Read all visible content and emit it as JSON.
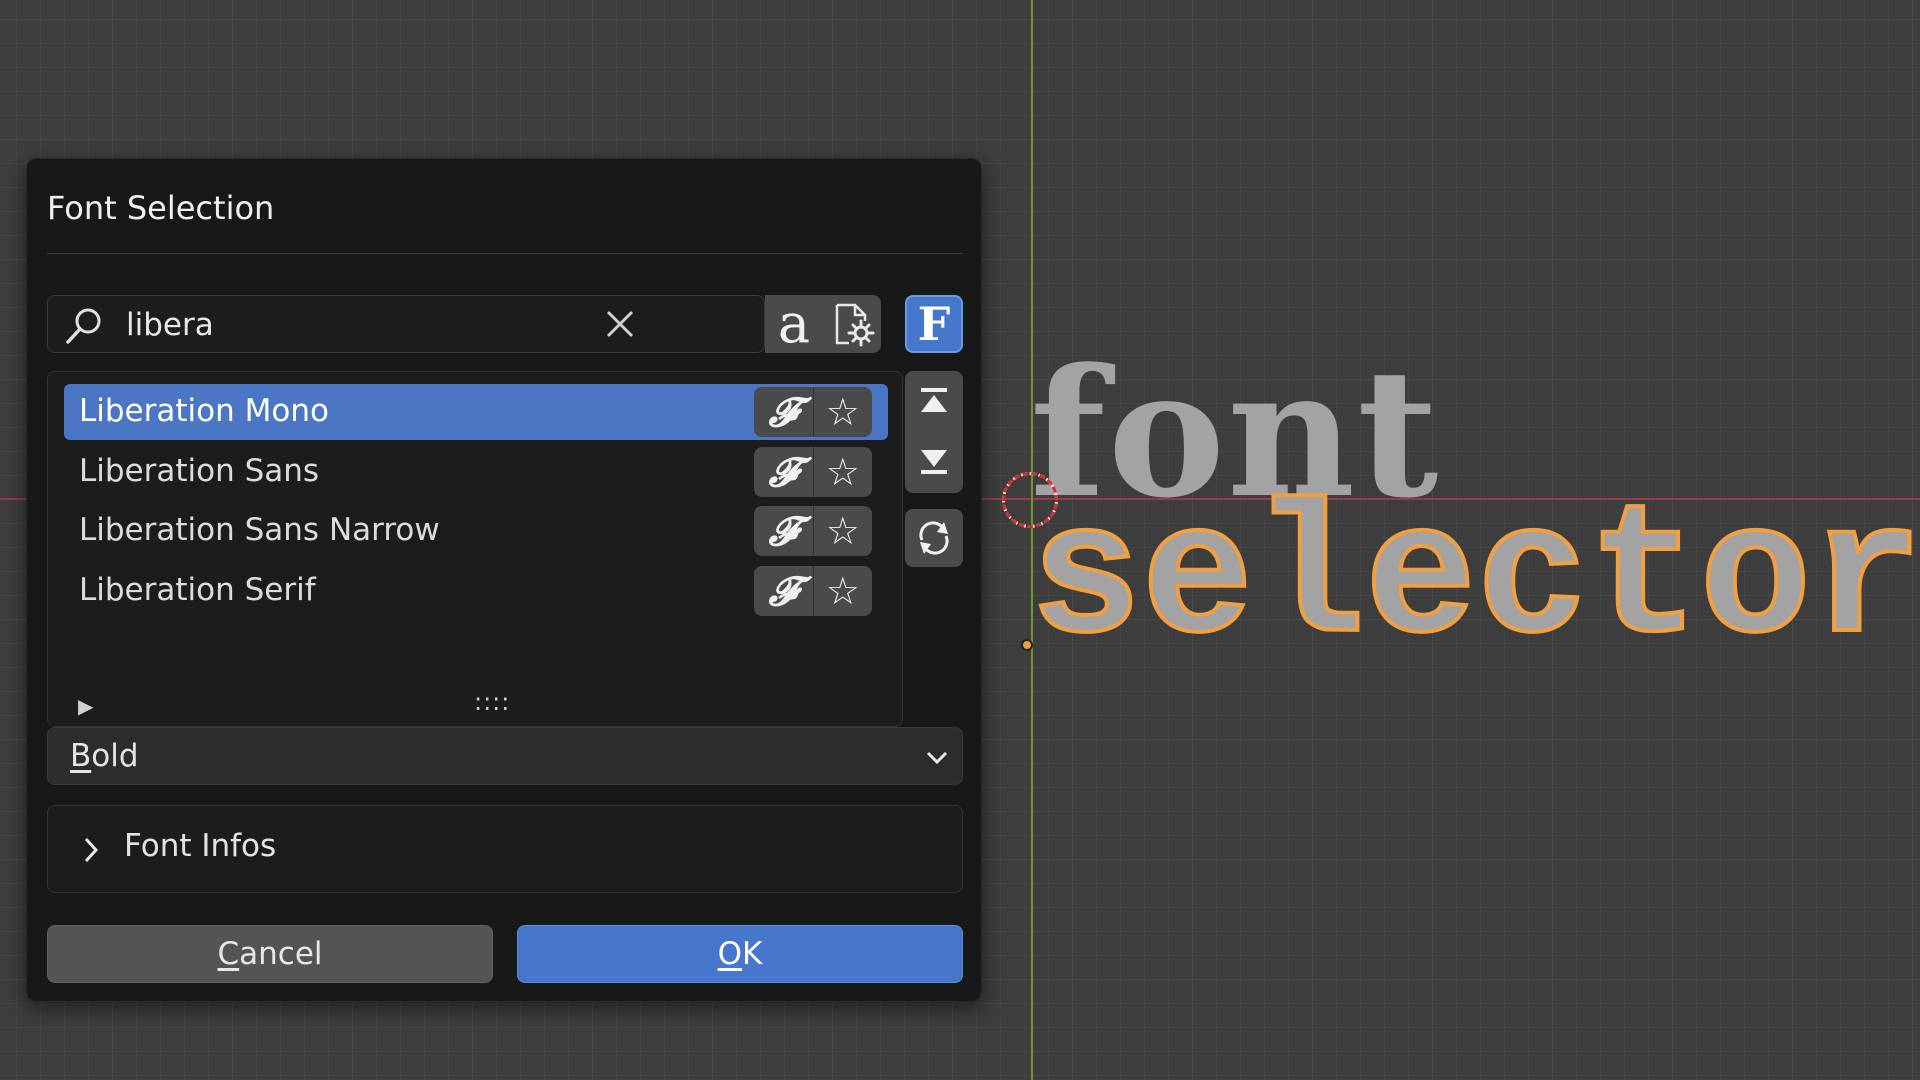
{
  "dialog": {
    "title": "Font Selection",
    "search": {
      "value": "libera",
      "placeholder": ""
    },
    "fonts": [
      {
        "label": "Liberation Mono",
        "selected": true
      },
      {
        "label": "Liberation Sans",
        "selected": false
      },
      {
        "label": "Liberation Sans Narrow",
        "selected": false
      },
      {
        "label": "Liberation Serif",
        "selected": false
      }
    ],
    "toolbar": {
      "sample_glyph": "a",
      "font_button_glyph": "F"
    },
    "row_font_glyph": "𝓕",
    "row_star_glyph": "☆",
    "expand_glyph": "▶",
    "grip_glyph": "::::",
    "style": {
      "first": "B",
      "rest": "old"
    },
    "font_infos_label": "Font Infos",
    "cancel": {
      "first": "C",
      "rest": "ancel"
    },
    "ok": {
      "first": "O",
      "rest": "K"
    }
  },
  "viewport": {
    "text_line1": "font",
    "text_line2": "selector"
  },
  "colors": {
    "accent": "#4677cc",
    "outline_selected": "#f0a040",
    "axis_x": "#9a3a44",
    "axis_y": "#6d9b2a"
  },
  "icons": {
    "search": "magnifier-icon",
    "clear": "close-icon",
    "sample": "font-sample-icon",
    "prefs": "file-settings-icon",
    "font_type": "font-type-icon",
    "favorite": "star-icon",
    "move_top": "move-top-icon",
    "move_bottom": "move-bottom-icon",
    "refresh": "refresh-icon",
    "dropdown": "chevron-down-icon",
    "disclosure": "chevron-right-icon"
  }
}
